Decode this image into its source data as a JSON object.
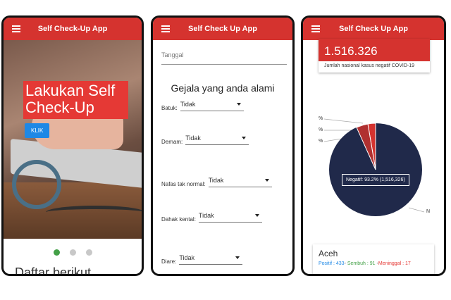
{
  "app": {
    "title_1": "Self Check-Up App",
    "title_2": "Self Check Up App",
    "title_3": "Self Check Up App"
  },
  "home": {
    "hero_title": "Lakukan Self Check-Up",
    "klik_label": "KLIK",
    "partial_text": "Daftar berikut"
  },
  "form": {
    "tanggal_placeholder": "Tanggal",
    "heading": "Gejala yang anda alami",
    "symptoms": [
      {
        "label": "Batuk:",
        "value": "Tidak"
      },
      {
        "label": "Demam:",
        "value": "Tidak"
      },
      {
        "label": "Nafas tak normal:",
        "value": "Tidak"
      },
      {
        "label": "Dahak kental:",
        "value": "Tidak"
      },
      {
        "label": "Diare:",
        "value": "Tidak"
      }
    ]
  },
  "stats": {
    "national_negative": "1.516.326",
    "national_negative_label": "Jumlah nasional kasus negatif COVID-19",
    "pie_labels": [
      "%",
      "%",
      "%"
    ],
    "tooltip": "Negatif: 93.2% (1,516,326)",
    "n_label": "N",
    "region": {
      "name": "Aceh",
      "positif": "Positif : 433",
      "sembuh": "Sembuh : 91",
      "meninggal": "Meninggal : 17"
    }
  },
  "colors": {
    "appbar": "#d5332f",
    "pie_negative": "#20294a",
    "pie_other": "#d5332f",
    "dot_active": "#43a047"
  }
}
